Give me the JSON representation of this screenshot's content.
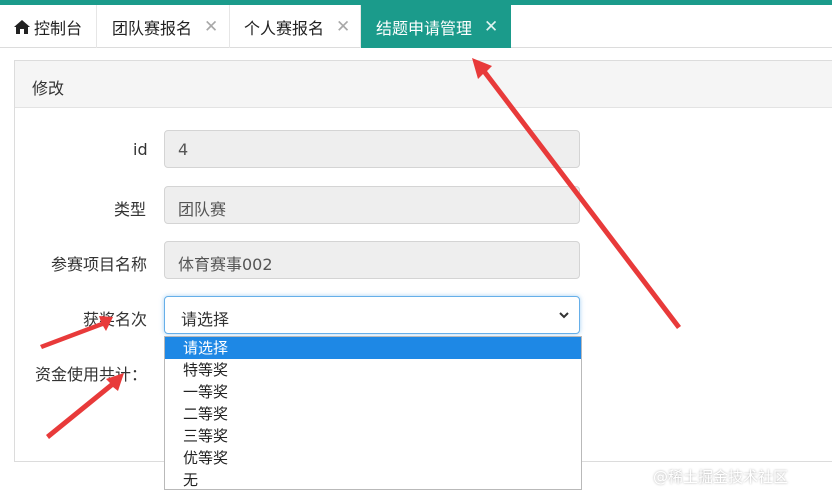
{
  "tabs": [
    {
      "label": "控制台",
      "icon": "home-icon",
      "closable": false
    },
    {
      "label": "团队赛报名",
      "closable": true
    },
    {
      "label": "个人赛报名",
      "closable": true
    },
    {
      "label": "结题申请管理",
      "closable": true,
      "active": true
    }
  ],
  "close_glyph": "✕",
  "colors": {
    "accent": "#1b9b8b",
    "highlight": "#1e88e5",
    "arrow": "#e83a3a"
  },
  "panel": {
    "title": "修改"
  },
  "form": {
    "id_label": "id",
    "id_value": "4",
    "type_label": "类型",
    "type_value": "团队赛",
    "project_label": "参赛项目名称",
    "project_value": "体育赛事002",
    "award_label": "获奖名次",
    "award_selected": "请选择",
    "funds_label": "资金使用共计："
  },
  "award_options": [
    "请选择",
    "特等奖",
    "一等奖",
    "二等奖",
    "三等奖",
    "优等奖",
    "无"
  ],
  "watermark": "@稀土掘金技术社区"
}
